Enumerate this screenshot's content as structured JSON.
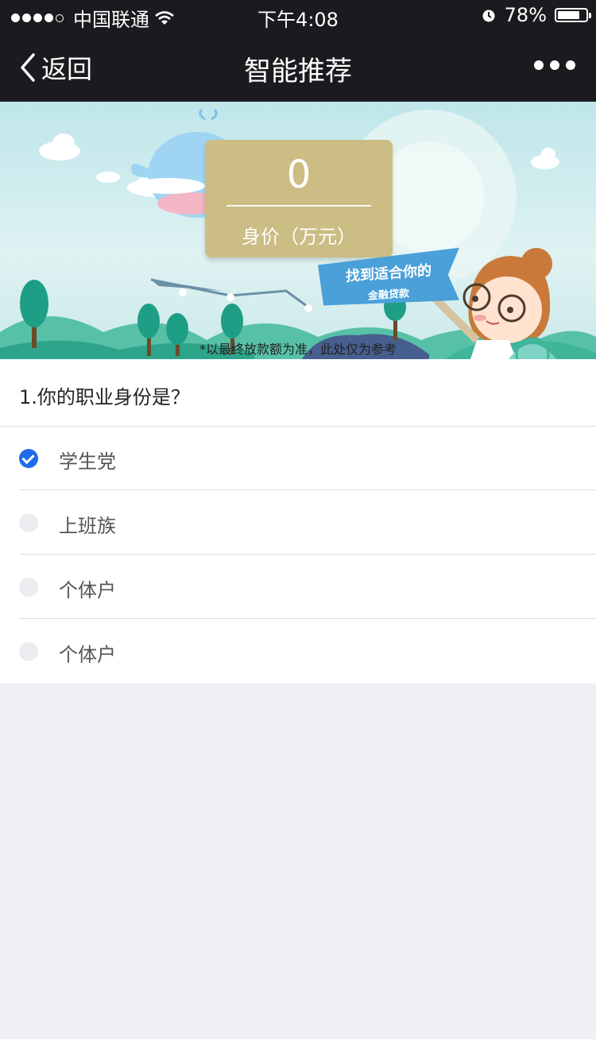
{
  "status_bar": {
    "carrier": "中国联通",
    "time": "下午4:08",
    "battery": "78%",
    "battery_level": 0.78
  },
  "nav": {
    "back_label": "返回",
    "title": "智能推荐"
  },
  "banner": {
    "value": "0",
    "value_label": "身价（万元）",
    "flag_main": "找到适合你的",
    "flag_sub": "金融贷款",
    "disclaimer": "*以最终放款额为准，此处仅为参考"
  },
  "question": {
    "text": "1.你的职业身份是？",
    "options": [
      {
        "label": "学生党",
        "checked": true
      },
      {
        "label": "上班族",
        "checked": false
      },
      {
        "label": "个体户",
        "checked": false
      },
      {
        "label": "个体户",
        "checked": false
      }
    ]
  },
  "colors": {
    "nav_bg": "#1b1b1f",
    "accent": "#1f6be8",
    "card": "#cbbd84",
    "page_bg": "#efeff4"
  }
}
